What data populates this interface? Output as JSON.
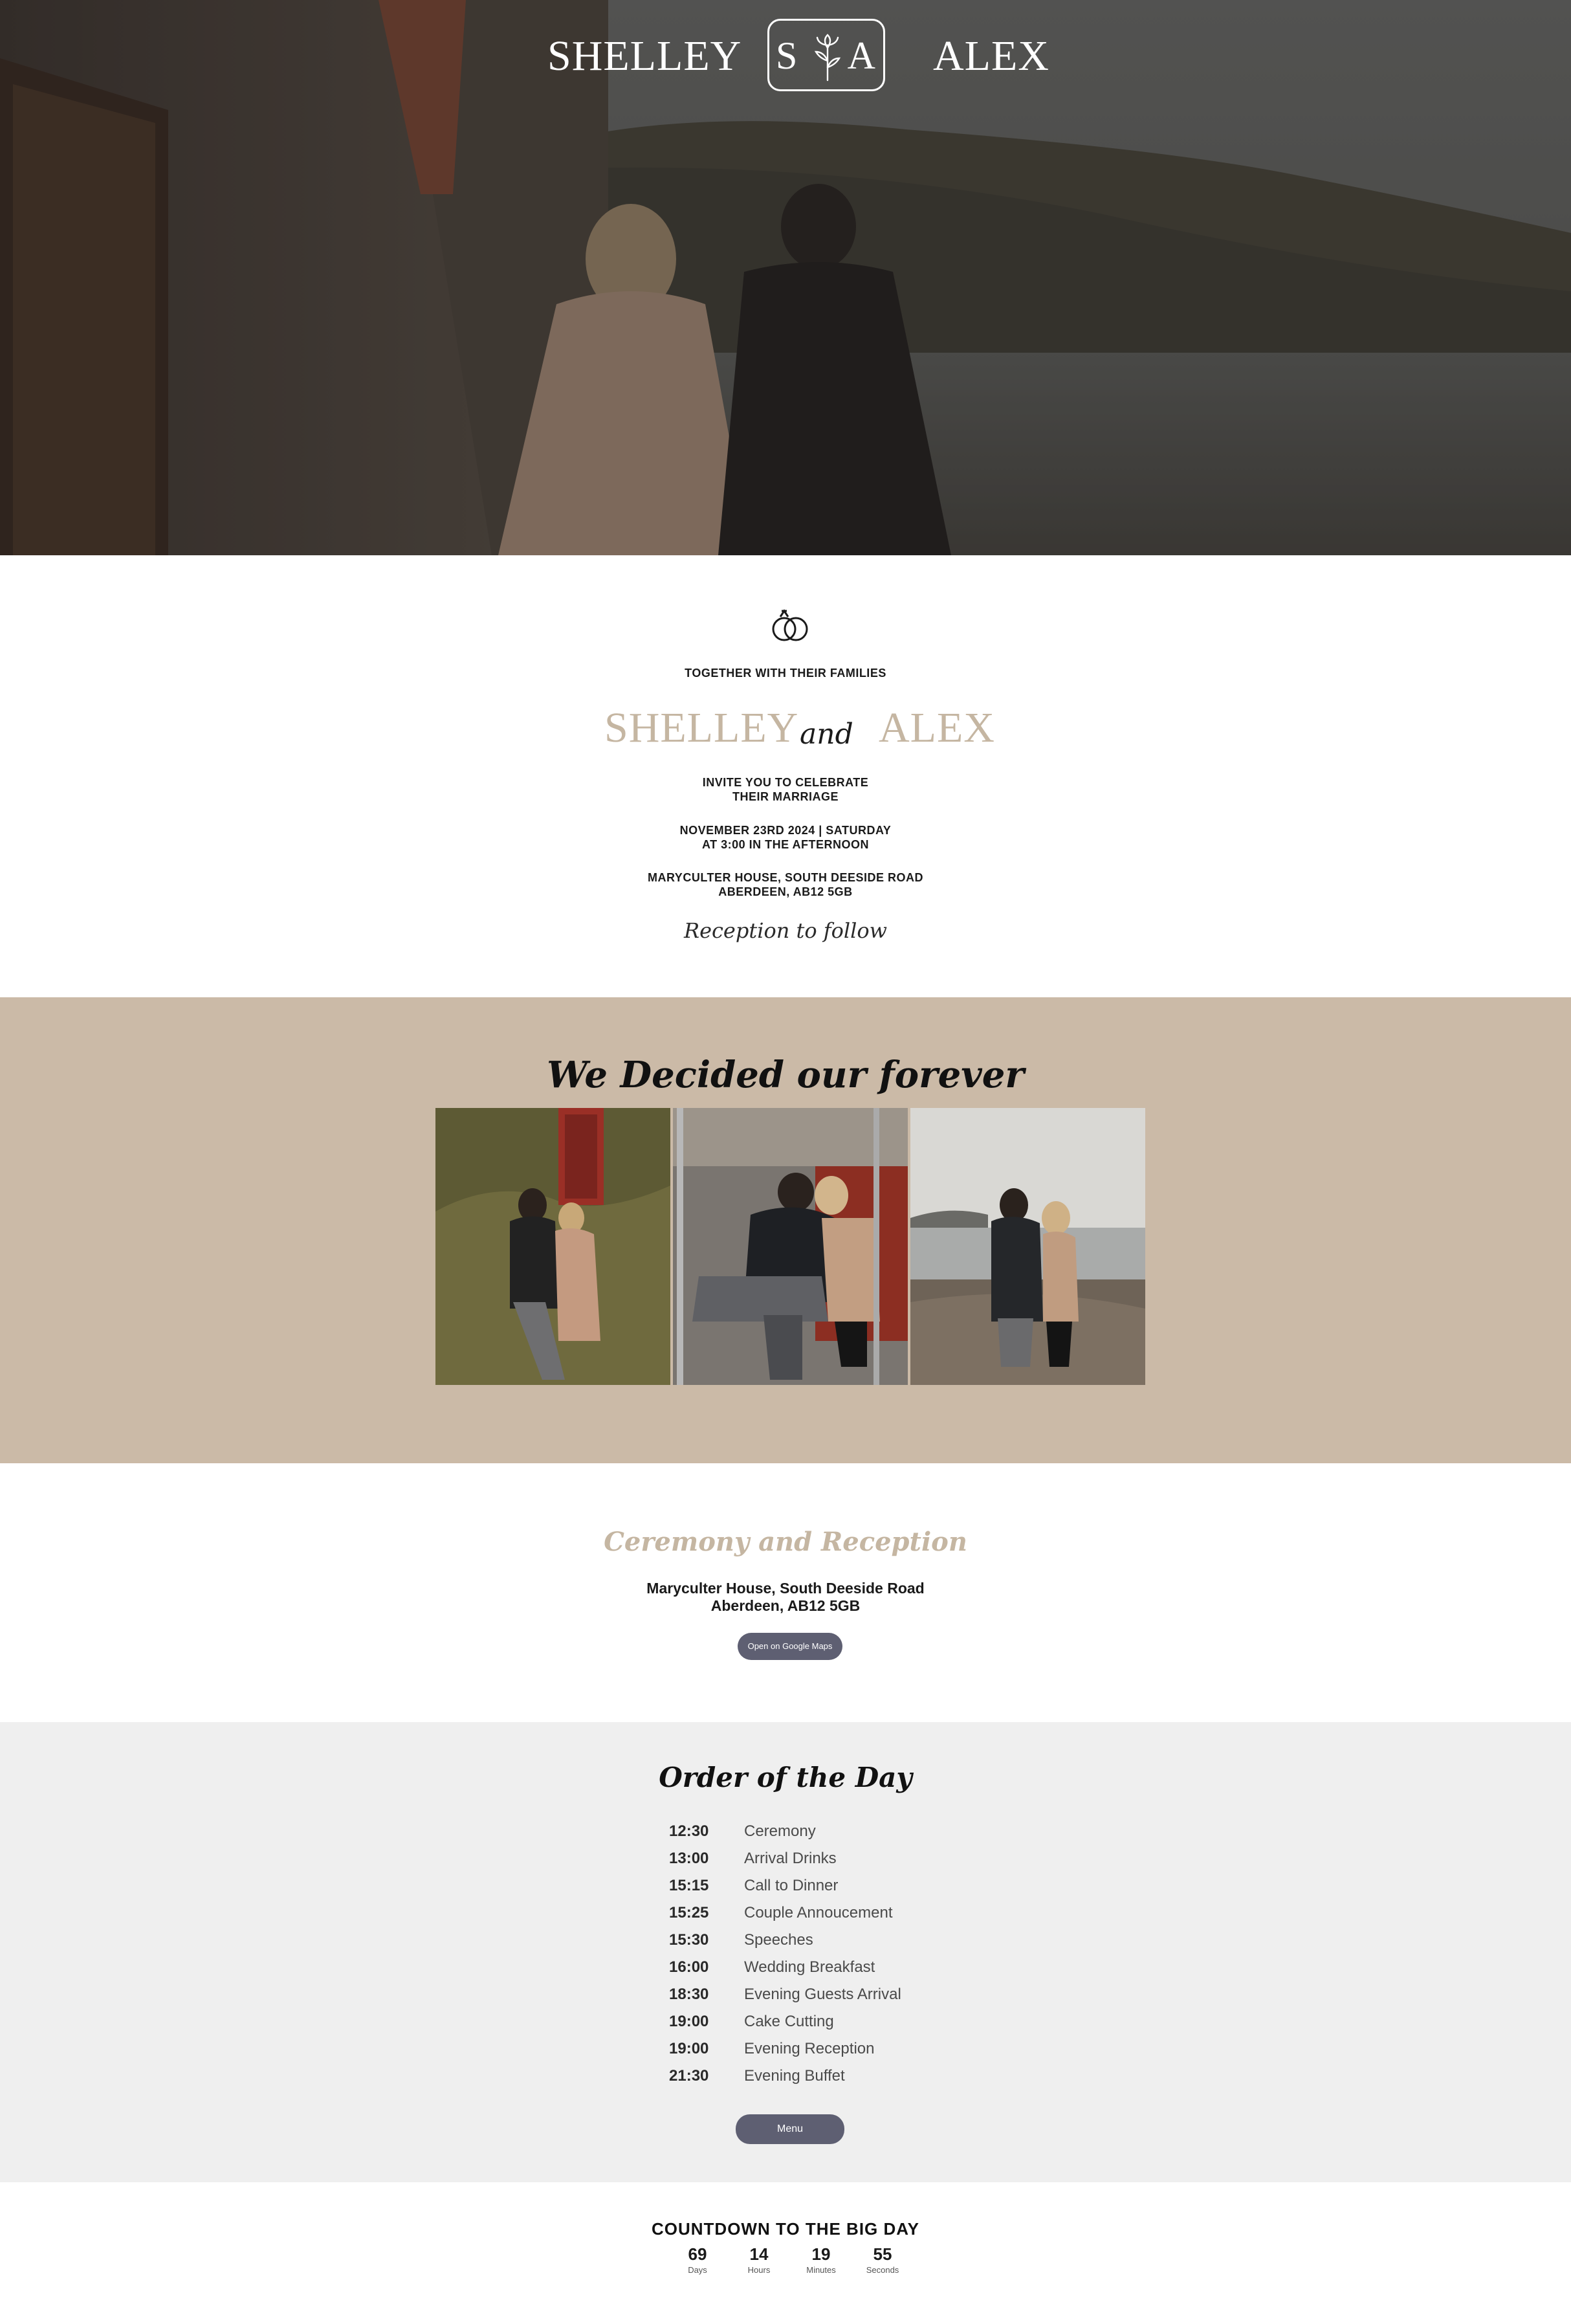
{
  "hero": {
    "name_left": "SHELLEY",
    "name_right": "ALEX",
    "monogram_left": "S",
    "monogram_right": "A"
  },
  "invite": {
    "intro": "TOGETHER WITH THEIR FAMILIES",
    "name_left": "SHELLEY",
    "connector": "and",
    "name_right": "ALEX",
    "line1": "INVITE YOU TO CELEBRATE",
    "line2": "THEIR MARRIAGE",
    "date_line1": "NOVEMBER 23RD 2024 | SATURDAY",
    "date_line2": "AT 3:00 IN THE AFTERNOON",
    "venue_line1": "MARYCULTER HOUSE, SOUTH DEESIDE ROAD",
    "venue_line2": "ABERDEEN, AB12 5GB",
    "reception": "Reception to follow"
  },
  "gallery": {
    "title": "We Decided our forever"
  },
  "venue": {
    "title": "Ceremony and Reception",
    "address_line1": "Maryculter House, South Deeside Road",
    "address_line2": "Aberdeen, AB12 5GB",
    "maps_button": "Open on Google Maps"
  },
  "order": {
    "title": "Order of the Day",
    "items": [
      {
        "time": "12:30",
        "event": "Ceremony"
      },
      {
        "time": "13:00",
        "event": "Arrival Drinks"
      },
      {
        "time": "15:15",
        "event": "Call to Dinner"
      },
      {
        "time": "15:25",
        "event": "Couple Annoucement"
      },
      {
        "time": "15:30",
        "event": "Speeches"
      },
      {
        "time": "16:00",
        "event": "Wedding Breakfast"
      },
      {
        "time": "18:30",
        "event": "Evening Guests Arrival"
      },
      {
        "time": "19:00",
        "event": "Cake Cutting"
      },
      {
        "time": "19:00",
        "event": "Evening Reception"
      },
      {
        "time": "21:30",
        "event": "Evening Buffet"
      }
    ],
    "menu_button": "Menu"
  },
  "countdown": {
    "title": "COUNTDOWN TO THE BIG DAY",
    "units": [
      {
        "value": "69",
        "label": "Days"
      },
      {
        "value": "14",
        "label": "Hours"
      },
      {
        "value": "19",
        "label": "Minutes"
      },
      {
        "value": "55",
        "label": "Seconds"
      }
    ]
  },
  "colors": {
    "accent_tan": "#c5b6a2",
    "gallery_bg": "#cbbaa7",
    "order_bg": "#efefef",
    "button": "#5e5f72"
  }
}
